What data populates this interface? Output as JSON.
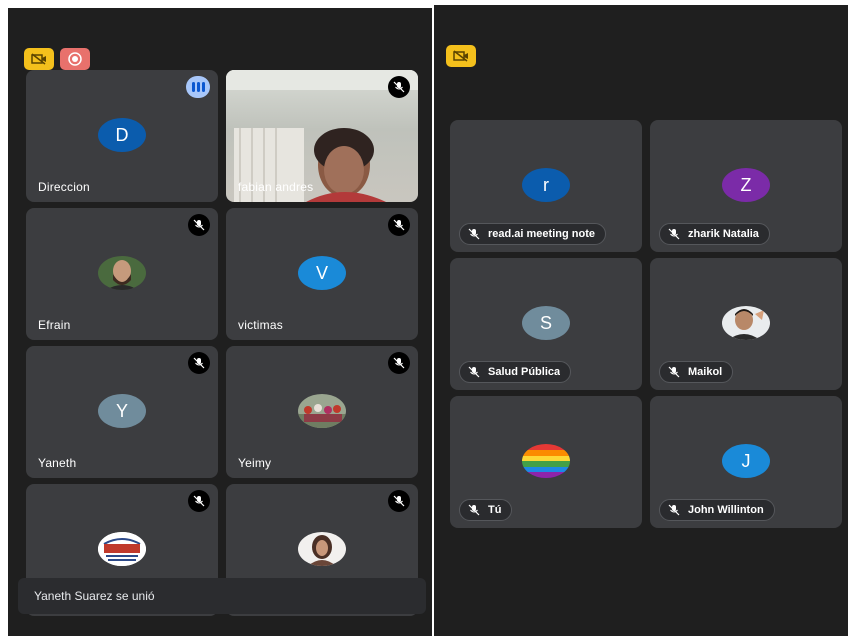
{
  "left_panel": {
    "tiles": [
      {
        "name": "Direccion",
        "avatar_letter": "D",
        "avatar_color": "#0b5cad",
        "status": "speaking"
      },
      {
        "name": "fabian andres",
        "status": "muted",
        "type": "video"
      },
      {
        "name": "Efrain",
        "status": "muted",
        "type": "photo"
      },
      {
        "name": "victimas",
        "avatar_letter": "V",
        "avatar_color": "#1a8ad8",
        "status": "muted"
      },
      {
        "name": "Yaneth",
        "avatar_letter": "Y",
        "avatar_color": "#708c9c",
        "status": "muted"
      },
      {
        "name": "Yeimy",
        "status": "muted",
        "type": "photo"
      },
      {
        "name": "",
        "status": "muted",
        "type": "logo",
        "logo_text": "AIEC"
      },
      {
        "name": "",
        "status": "muted",
        "type": "photo"
      }
    ],
    "toast": "Yaneth Suarez se unió"
  },
  "right_panel": {
    "tiles": [
      {
        "name": "read.ai meeting note",
        "avatar_letter": "r",
        "avatar_color": "#0b5cad"
      },
      {
        "name": "zharik Natalia",
        "avatar_letter": "Z",
        "avatar_color": "#7b2ba8"
      },
      {
        "name": "Salud Pública",
        "avatar_letter": "S",
        "avatar_color": "#708c9c"
      },
      {
        "name": "Maikol",
        "type": "photo"
      },
      {
        "name": "Tú",
        "type": "rainbow"
      },
      {
        "name": "John Willinton",
        "avatar_letter": "J",
        "avatar_color": "#1a8ad8"
      }
    ]
  },
  "colors": {
    "accent": "#a8c7fa",
    "camera_off": "#f4c01c",
    "recording": "#e8716c"
  }
}
